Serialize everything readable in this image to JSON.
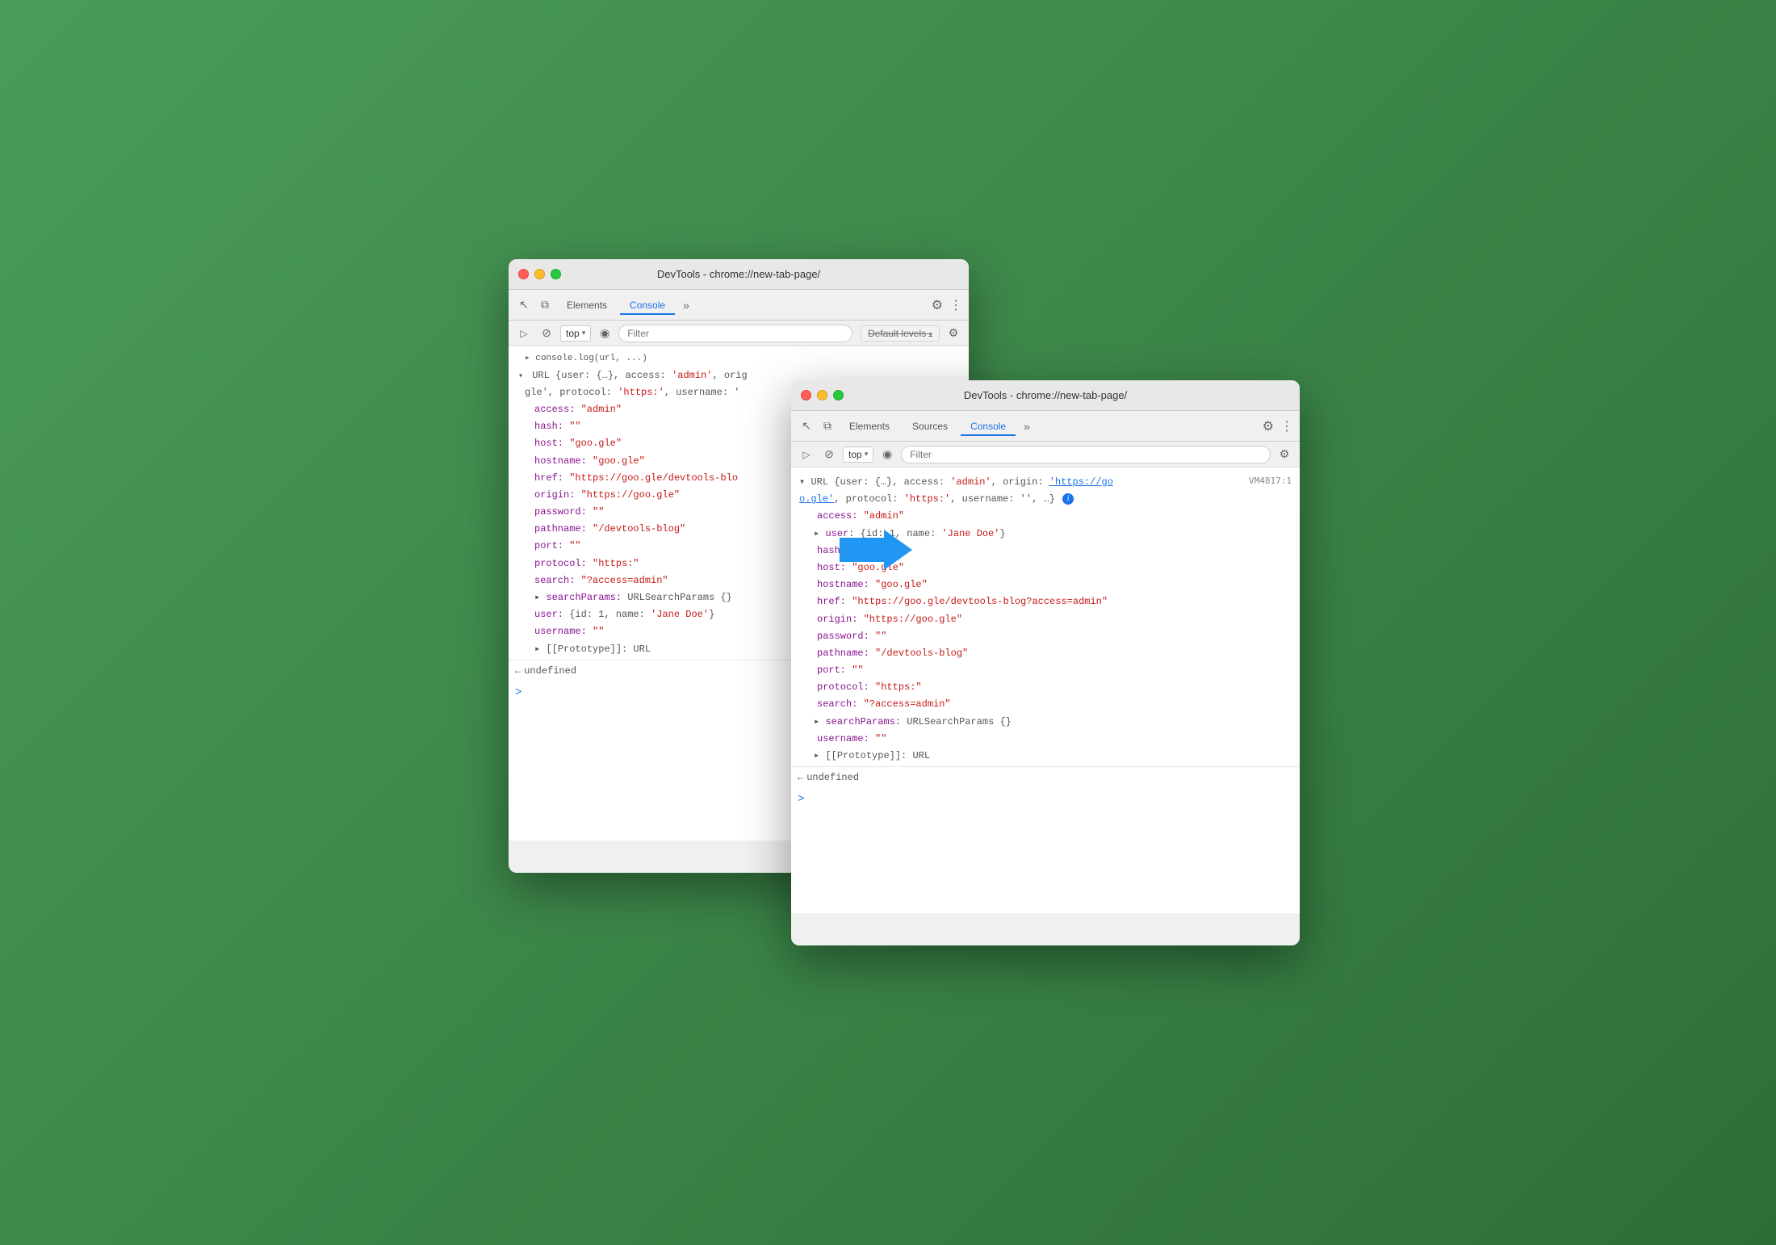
{
  "scene": {
    "background_color": "#4a9c5a"
  },
  "window_back": {
    "title": "DevTools - chrome://new-tab-page/",
    "tabs": {
      "elements": "Elements",
      "console": "Console",
      "more": "»"
    },
    "toolbar": {
      "top_label": "top",
      "filter_placeholder": "Filter",
      "default_levels": "Default levels"
    },
    "console_log_header": "URL {user: {…}, access: 'admin', orig",
    "console_log_header2": "gle', protocol: 'https:', username: '",
    "properties": [
      {
        "key": "access:",
        "value": "\"admin\"",
        "color": "string"
      },
      {
        "key": "hash:",
        "value": "\"\"",
        "color": "string"
      },
      {
        "key": "host:",
        "value": "\"goo.gle\"",
        "color": "string"
      },
      {
        "key": "hostname:",
        "value": "\"goo.gle\"",
        "color": "string"
      },
      {
        "key": "href:",
        "value": "\"https://goo.gle/devtools-blo",
        "color": "string"
      },
      {
        "key": "origin:",
        "value": "\"https://goo.gle\"",
        "color": "string"
      },
      {
        "key": "password:",
        "value": "\"\"",
        "color": "string"
      },
      {
        "key": "pathname:",
        "value": "\"/devtools-blog\"",
        "color": "string"
      },
      {
        "key": "port:",
        "value": "\"\"",
        "color": "string"
      },
      {
        "key": "protocol:",
        "value": "\"https:\"",
        "color": "string"
      },
      {
        "key": "search:",
        "value": "\"?access=admin\"",
        "color": "string"
      },
      {
        "key": "searchParams:",
        "value": "URLSearchParams {}",
        "color": "purple"
      },
      {
        "key": "user:",
        "value": "{id: 1, name: 'Jane Doe'}",
        "color": "dark"
      },
      {
        "key": "username:",
        "value": "\"\"",
        "color": "string"
      },
      {
        "key": "[[Prototype]]:",
        "value": "URL",
        "color": "purple"
      }
    ],
    "undefined_text": "undefined",
    "prompt_text": ">"
  },
  "window_front": {
    "title": "DevTools - chrome://new-tab-page/",
    "tabs": {
      "elements": "Elements",
      "sources": "Sources",
      "console": "Console",
      "more": "»"
    },
    "toolbar": {
      "top_label": "top",
      "filter_placeholder": "Filter"
    },
    "vm_ref": "VM4817:1",
    "console_log_header": "URL {user: {…}, access: 'admin', origin: 'https://go",
    "console_log_header2": "o.gle', protocol: 'https:', username: '', …}",
    "properties": [
      {
        "key": "access:",
        "value": "\"admin\"",
        "color": "string",
        "indent": 1
      },
      {
        "key": "user:",
        "value": "{id: 1, name: 'Jane Doe'}",
        "color": "dark",
        "expandable": true,
        "indent": 1
      },
      {
        "key": "hash:",
        "value": "\"\"",
        "color": "string",
        "indent": 1
      },
      {
        "key": "host:",
        "value": "\"goo.gle\"",
        "color": "string",
        "indent": 1
      },
      {
        "key": "hostname:",
        "value": "\"goo.gle\"",
        "color": "string",
        "indent": 1
      },
      {
        "key": "href:",
        "value": "\"https://goo.gle/devtools-blog?access=admin\"",
        "color": "string",
        "indent": 1
      },
      {
        "key": "origin:",
        "value": "\"https://goo.gle\"",
        "color": "string",
        "indent": 1
      },
      {
        "key": "password:",
        "value": "\"\"",
        "color": "string",
        "indent": 1
      },
      {
        "key": "pathname:",
        "value": "\"/devtools-blog\"",
        "color": "string",
        "indent": 1
      },
      {
        "key": "port:",
        "value": "\"\"",
        "color": "string",
        "indent": 1
      },
      {
        "key": "protocol:",
        "value": "\"https:\"",
        "color": "string",
        "indent": 1
      },
      {
        "key": "search:",
        "value": "\"?access=admin\"",
        "color": "string",
        "indent": 1
      },
      {
        "key": "searchParams:",
        "value": "URLSearchParams {}",
        "color": "purple",
        "expandable": true,
        "indent": 1
      },
      {
        "key": "username:",
        "value": "\"\"",
        "color": "string",
        "indent": 1
      },
      {
        "key": "[[Prototype]]:",
        "value": "URL",
        "color": "purple",
        "expandable": true,
        "indent": 1
      }
    ],
    "undefined_text": "undefined",
    "prompt_text": ">"
  },
  "arrow": {
    "color": "#2196F3",
    "direction": "right"
  },
  "icons": {
    "cursor": "↖",
    "layers": "⧉",
    "ban": "⊘",
    "eye": "◉",
    "gear": "⚙",
    "more_vert": "⋮",
    "play": "▷",
    "info": "i"
  }
}
